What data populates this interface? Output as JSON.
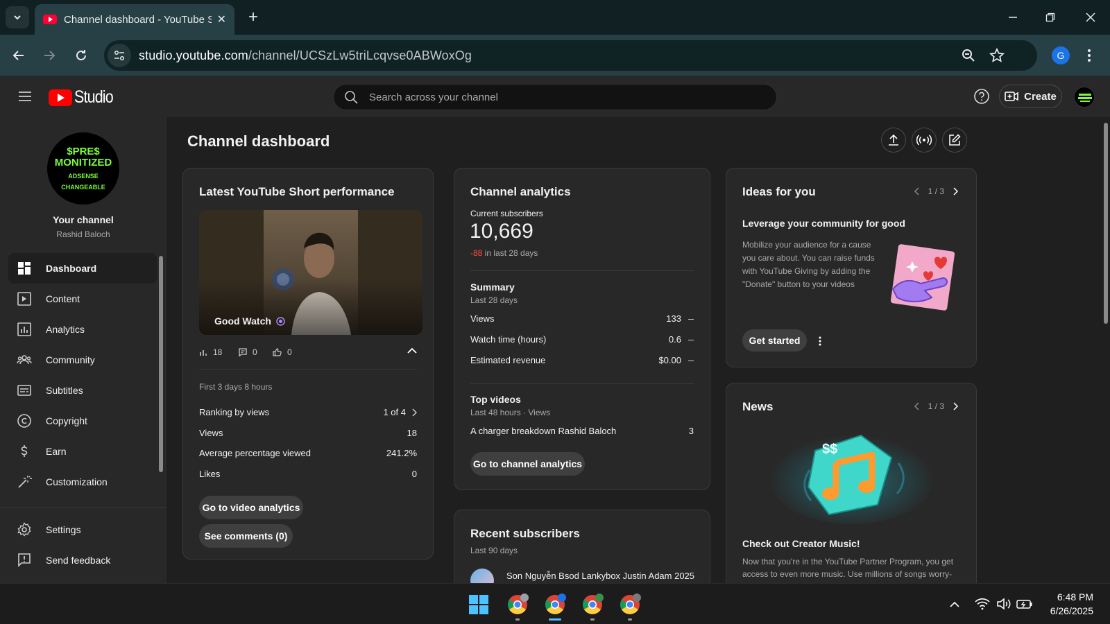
{
  "browser": {
    "tab_title": "Channel dashboard - YouTube Studio",
    "url_host": "studio.youtube.com",
    "url_path": "/channel/UCSzLw5triLcqvse0ABWoxOg",
    "profile_initial": "G"
  },
  "header": {
    "logo_text": "Studio",
    "search_placeholder": "Search across your channel",
    "create_label": "Create"
  },
  "sidebar": {
    "avatar_line1": "$PRE$",
    "avatar_line2": "MONITIZED",
    "avatar_line3": "ADSENSE",
    "avatar_line4": "CHANGEABLE",
    "channel_title": "Your channel",
    "channel_name": "Rashid Baloch",
    "items": [
      {
        "label": "Dashboard",
        "icon": "dashboard-icon"
      },
      {
        "label": "Content",
        "icon": "content-icon"
      },
      {
        "label": "Analytics",
        "icon": "analytics-icon"
      },
      {
        "label": "Community",
        "icon": "community-icon"
      },
      {
        "label": "Subtitles",
        "icon": "subtitles-icon"
      },
      {
        "label": "Copyright",
        "icon": "copyright-icon"
      },
      {
        "label": "Earn",
        "icon": "earn-icon"
      },
      {
        "label": "Customization",
        "icon": "customization-icon"
      }
    ],
    "bottom_items": [
      {
        "label": "Settings",
        "icon": "settings-icon"
      },
      {
        "label": "Send feedback",
        "icon": "feedback-icon"
      }
    ]
  },
  "page_title": "Channel dashboard",
  "short_card": {
    "title": "Latest YouTube Short performance",
    "video_title": "Good Watch",
    "views_count": "18",
    "comments_count": "0",
    "likes_count": "0",
    "period": "First 3 days 8 hours",
    "ranking_label": "Ranking by views",
    "ranking_value": "1 of 4",
    "views_label": "Views",
    "views_value": "18",
    "avg_label": "Average percentage viewed",
    "avg_value": "241.2%",
    "likes_label": "Likes",
    "likes_value": "0",
    "btn_analytics": "Go to video analytics",
    "btn_comments": "See comments (0)"
  },
  "analytics_card": {
    "title": "Channel analytics",
    "subs_label": "Current subscribers",
    "subs_value": "10,669",
    "subs_change": "-88",
    "subs_change_suffix": "in last 28 days",
    "summary_title": "Summary",
    "summary_period": "Last 28 days",
    "rows": [
      {
        "label": "Views",
        "value": "133"
      },
      {
        "label": "Watch time (hours)",
        "value": "0.6"
      },
      {
        "label": "Estimated revenue",
        "value": "$0.00"
      }
    ],
    "top_title": "Top videos",
    "top_period": "Last 48 hours · Views",
    "top_video": "A charger breakdown Rashid Baloch",
    "top_video_views": "3",
    "btn": "Go to channel analytics"
  },
  "subscribers_card": {
    "title": "Recent subscribers",
    "period": "Last 90 days",
    "first_name": "Son Nguyễn Bsod Lankybox Justin Adam 2025"
  },
  "ideas_card": {
    "title": "Ideas for you",
    "pager": "1 / 3",
    "heading": "Leverage your community for good",
    "body": "Mobilize your audience for a cause you care about. You can raise funds with YouTube Giving by adding the \"Donate\" button to your videos",
    "btn": "Get started"
  },
  "news_card": {
    "title": "News",
    "pager": "1 / 3",
    "heading": "Check out Creator Music!",
    "body": "Now that you're in the YouTube Partner Program, you get access to even more music. Use millions of songs worry-free"
  },
  "taskbar": {
    "time": "6:48 PM",
    "date": "6/26/2025"
  },
  "colors": {
    "accent_red": "#ff0000",
    "negative": "#ff4e45"
  }
}
